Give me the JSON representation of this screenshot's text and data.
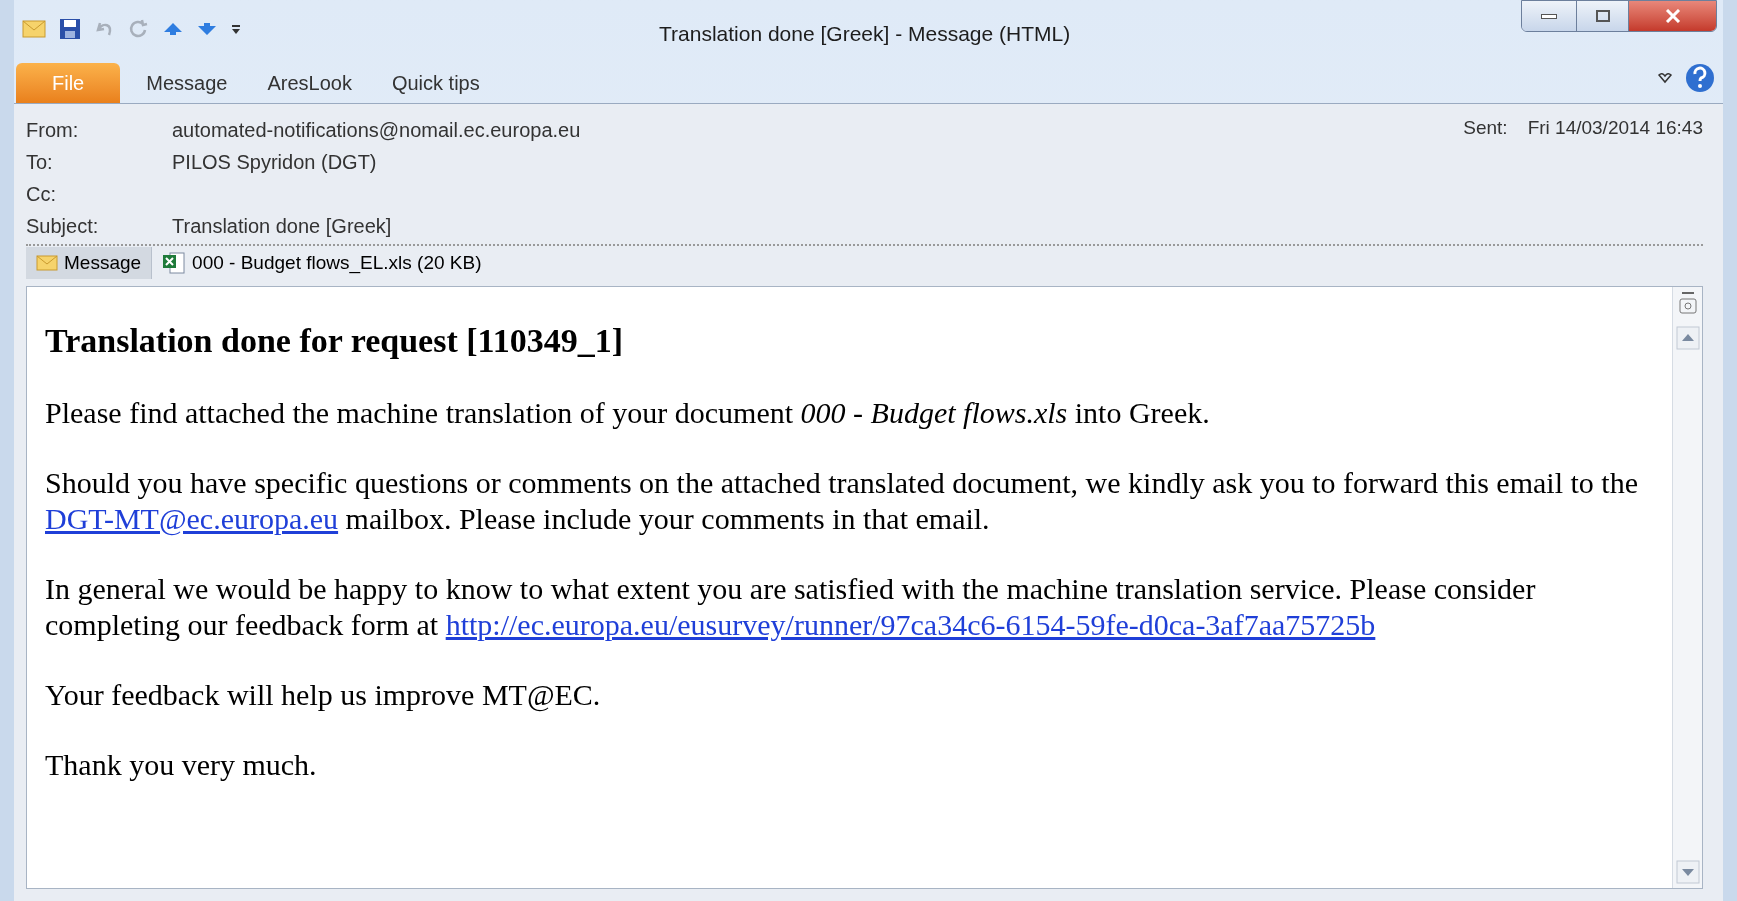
{
  "window": {
    "title": "Translation done [Greek]  -  Message (HTML)"
  },
  "ribbon_tabs": [
    {
      "label": "File",
      "selected": true
    },
    {
      "label": "Message",
      "selected": false
    },
    {
      "label": "AresLook",
      "selected": false
    },
    {
      "label": "Quick tips",
      "selected": false
    }
  ],
  "header": {
    "fields": [
      {
        "label": "From:",
        "value": "automated-notifications@nomail.ec.europa.eu"
      },
      {
        "label": "To:",
        "value": "PILOS Spyridon (DGT)"
      },
      {
        "label": "Cc:"
      },
      {
        "label": "Subject:",
        "value": "Translation done [Greek]"
      }
    ],
    "sent_label": "Sent:",
    "sent_value": "Fri 14/03/2014 16:43"
  },
  "attachments": [
    {
      "label": "Message",
      "kind": "message",
      "selected": true
    },
    {
      "label": "000 - Budget flows_EL.xls (20 KB)",
      "kind": "excel",
      "selected": false
    }
  ],
  "body": {
    "heading": "Translation done for request [110349_1]",
    "paragraphs": [
      [
        {
          "kind": "text",
          "text": "Please find attached the machine translation of your document *000 - Budget flows.xls* into Greek."
        }
      ],
      [
        {
          "kind": "text",
          "text": "Should you have specific questions or comments on the attached translated document, we kindly ask you to forward this email to the"
        },
        {
          "kind": "link",
          "text": "DGT-MT@ec.europa.eu"
        },
        {
          "kind": "text",
          "text": "mailbox. Please include your comments in that email."
        }
      ],
      [
        {
          "kind": "text",
          "text": "In general we would be happy to know to what extent you are satisfied with the machine translation service. Please consider completing our feedback form at"
        },
        {
          "kind": "link",
          "text": "http://ec.europa.eu/eusurvey/runner/97ca34c6-6154-59fe-d0ca-3af7aa75725b"
        }
      ],
      [
        {
          "kind": "text",
          "text": "Your feedback will help us improve MT@EC."
        }
      ],
      [
        {
          "kind": "text",
          "text": "Thank you very much."
        }
      ]
    ]
  }
}
